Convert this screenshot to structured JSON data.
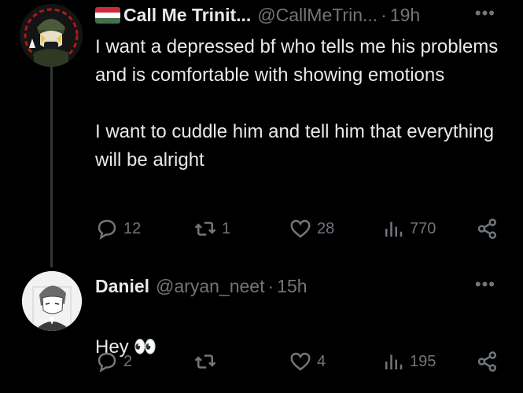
{
  "colors": {
    "background": "#000000",
    "text_primary": "#e7e9ea",
    "text_secondary": "#71767b",
    "thread_line": "#333639"
  },
  "tweet1": {
    "display_name": "Call Me Trinit...",
    "handle": "@CallMeTrin...",
    "separator": "·",
    "time": "19h",
    "more": "•••",
    "text": "I want a depressed bf who tells me his problems and is comfortable with showing emotions\n\nI want to cuddle him and tell him that everything will be alright",
    "replies": "12",
    "reposts": "1",
    "likes": "28",
    "views": "770",
    "flag_icon": "hungary-flag-icon"
  },
  "tweet2": {
    "display_name": "Daniel",
    "handle": "@aryan_neet",
    "separator": "·",
    "time": "15h",
    "more": "•••",
    "text": "Hey",
    "emoji": "👀",
    "replies": "2",
    "reposts": "",
    "likes": "4",
    "views": "195"
  }
}
